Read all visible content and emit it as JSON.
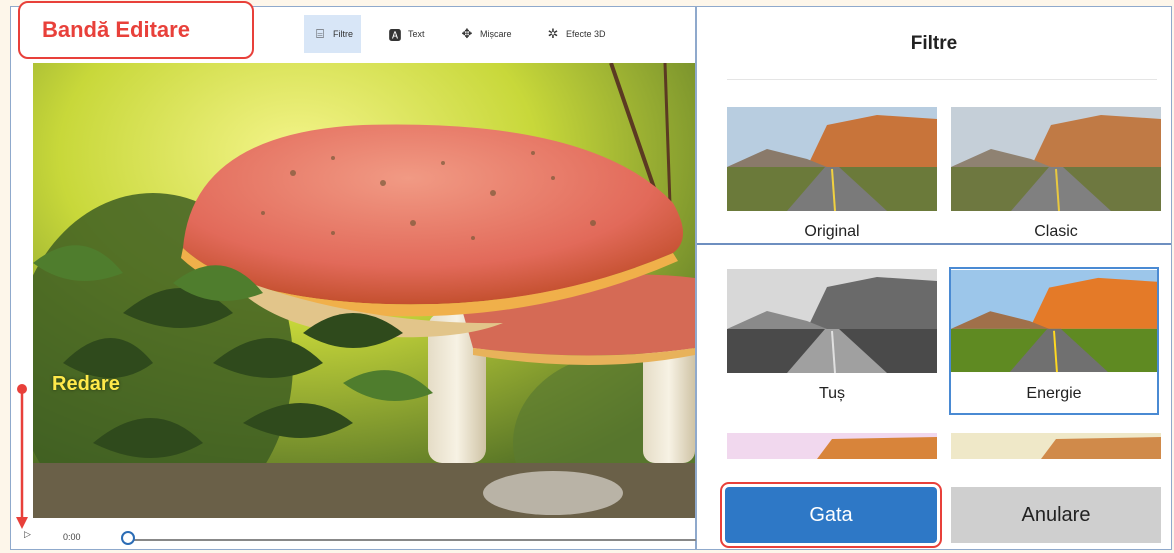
{
  "annotations": {
    "editing_band": "Bandă Editare",
    "playback": "Redare"
  },
  "toolbar": {
    "items": [
      {
        "label": "Filtre",
        "icon": "filter-icon",
        "active": true
      },
      {
        "label": "Text",
        "icon": "text-icon",
        "active": false
      },
      {
        "label": "Mișcare",
        "icon": "motion-icon",
        "active": false
      },
      {
        "label": "Efecte 3D",
        "icon": "effects-3d-icon",
        "active": false
      }
    ]
  },
  "timeline": {
    "time": "0:00",
    "progress": 0
  },
  "panel": {
    "title": "Filtre",
    "filters": [
      {
        "name": "Original",
        "style": "color"
      },
      {
        "name": "Clasic",
        "style": "color"
      },
      {
        "name": "Tuș",
        "style": "bw"
      },
      {
        "name": "Energie",
        "style": "vivid",
        "selected": true
      }
    ],
    "buttons": {
      "done": "Gata",
      "cancel": "Anulare"
    }
  },
  "colors": {
    "accent": "#2e78c6",
    "annotation": "#e8403a",
    "playback_label": "#ffe94a"
  }
}
